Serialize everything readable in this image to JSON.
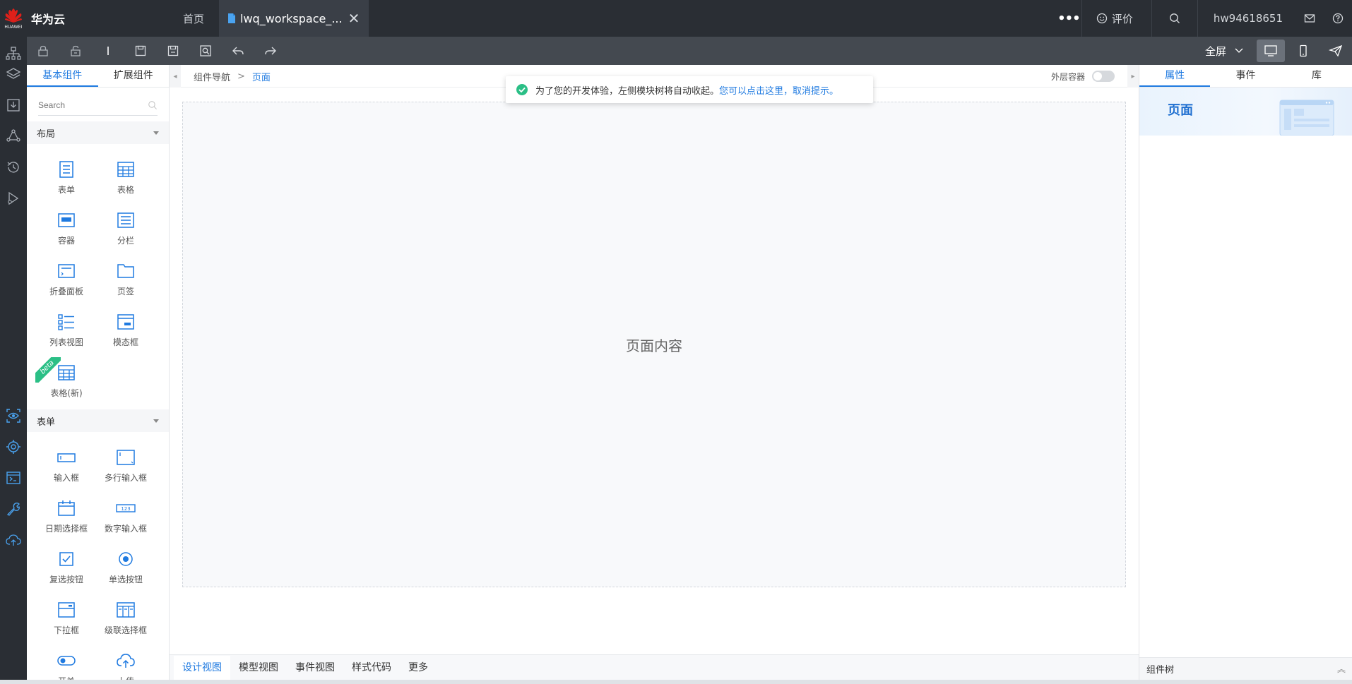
{
  "topbar": {
    "logo_text": "HUAWEI",
    "brand": "华为云",
    "home_tab": "首页",
    "file_tab": "lwq_workspace_...",
    "close_glyph": "✕",
    "more_glyph": "•••",
    "rate_label": "评价",
    "username": "hw94618651"
  },
  "toolbar": {
    "fullscreen_label": "全屏"
  },
  "component_panel": {
    "tabs": [
      "基本组件",
      "扩展组件"
    ],
    "search_placeholder": "Search",
    "groups": [
      {
        "title": "布局",
        "items": [
          "表单",
          "表格",
          "容器",
          "分栏",
          "折叠面板",
          "页签",
          "列表视图",
          "模态框",
          "表格(新)"
        ],
        "beta_label": "beta"
      },
      {
        "title": "表单",
        "items": [
          "输入框",
          "多行输入框",
          "日期选择框",
          "数字输入框",
          "复选按钮",
          "单选按钮",
          "下拉框",
          "级联选择框",
          "开关",
          "上传"
        ]
      }
    ]
  },
  "canvas": {
    "breadcrumb_root": "组件导航",
    "breadcrumb_sep": ">",
    "breadcrumb_current": "页面",
    "outer_container_label": "外层容器",
    "page_content": "页面内容",
    "bottom_tabs": [
      "设计视图",
      "模型视图",
      "事件视图",
      "样式代码",
      "更多"
    ]
  },
  "toast": {
    "message": "为了您的开发体验，左侧模块树将自动收起。",
    "link": "您可以点击这里，取消提示。"
  },
  "property_panel": {
    "tabs": [
      "属性",
      "事件",
      "库"
    ],
    "title": "页面",
    "tree_label": "组件树",
    "collapse_glyph": "︽"
  },
  "colors": {
    "accent": "#1f7ae0",
    "topbar_bg": "#2a2e34",
    "toolbar_bg": "#444950",
    "success": "#2bbf86"
  }
}
